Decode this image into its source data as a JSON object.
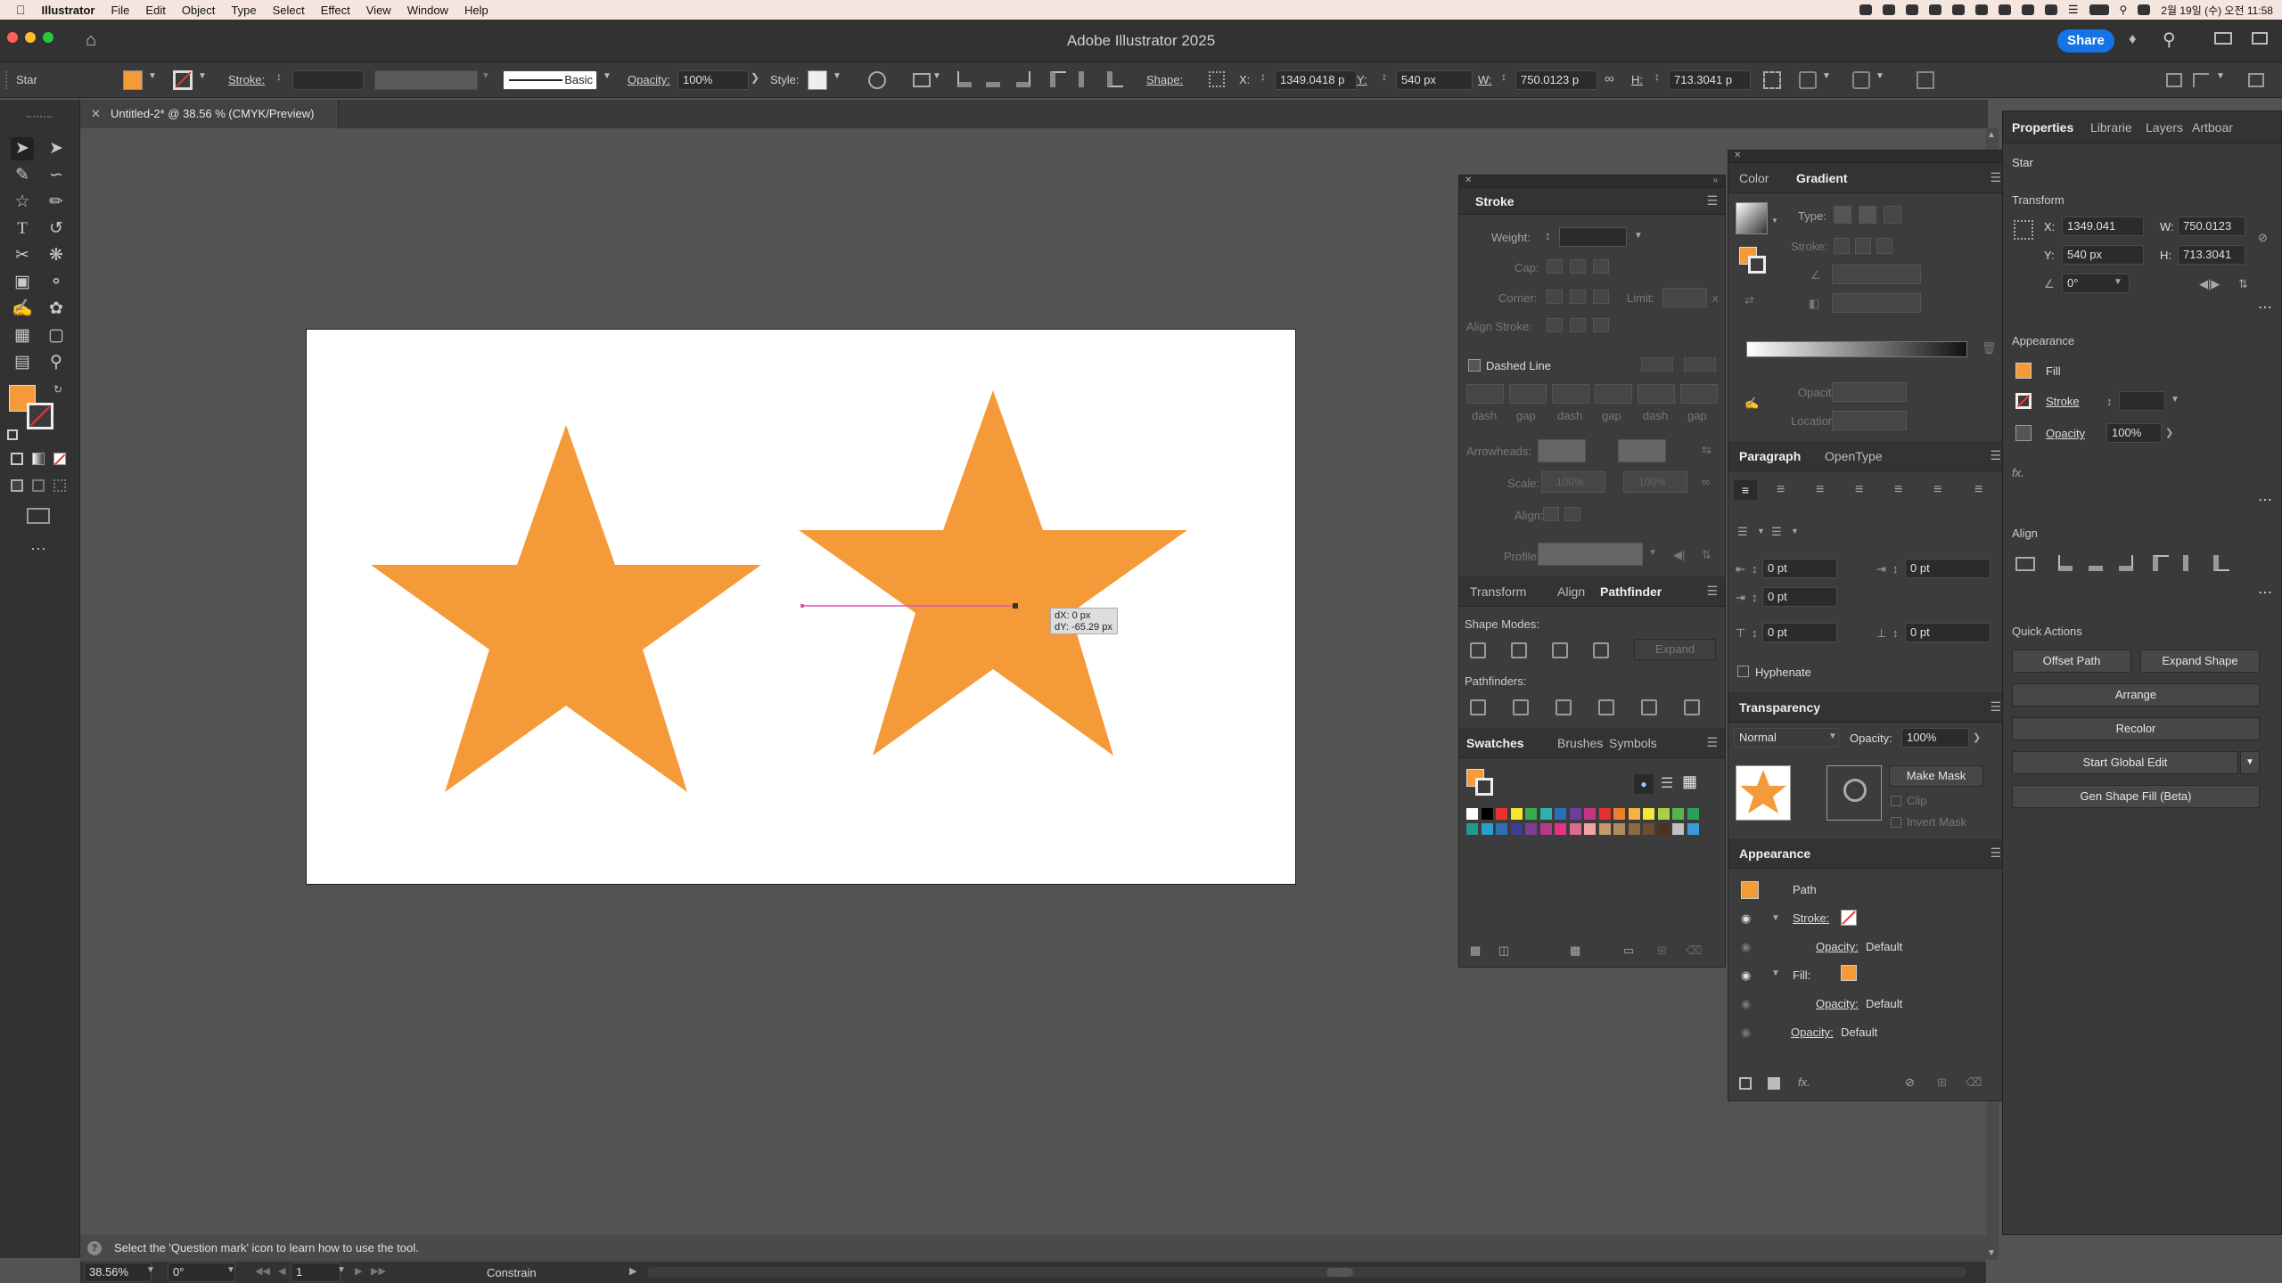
{
  "menubar": {
    "app": "Illustrator",
    "items": [
      "File",
      "Edit",
      "Object",
      "Type",
      "Select",
      "Effect",
      "View",
      "Window",
      "Help"
    ],
    "datetime": "2월 19일 (수) 오전 11:58"
  },
  "titlebar": {
    "title": "Adobe Illustrator 2025",
    "share": "Share"
  },
  "control": {
    "object_type": "Star",
    "stroke_label": "Stroke:",
    "brush_label": "Basic",
    "opacity_label": "Opacity:",
    "opacity_value": "100%",
    "style_label": "Style:",
    "shape_label": "Shape:",
    "x_label": "X:",
    "x_value": "1349.0418 p",
    "y_label": "Y:",
    "y_value": "540 px",
    "w_label": "W:",
    "w_value": "750.0123 p",
    "h_label": "H:",
    "h_value": "713.3041 p"
  },
  "document_tab": {
    "title": "Untitled-2* @ 38.56 % (CMYK/Preview)"
  },
  "canvas": {
    "tooltip_dx": "dX: 0 px",
    "tooltip_dy": "dY: -65.29 px",
    "fill_color": "#f59a38"
  },
  "status": {
    "hint": "Select the 'Question mark' icon to learn how to use the tool.",
    "zoom": "38.56%",
    "rotation": "0°",
    "artboard_num": "1",
    "mode": "Constrain"
  },
  "stroke_panel": {
    "title": "Stroke",
    "weight": "Weight:",
    "cap": "Cap:",
    "corner": "Corner:",
    "limit": "Limit:",
    "limit_x": "x",
    "align_stroke": "Align Stroke:",
    "dashed_line": "Dashed Line",
    "dash_labels": [
      "dash",
      "gap",
      "dash",
      "gap",
      "dash",
      "gap"
    ],
    "arrowheads": "Arrowheads:",
    "scale": "Scale:",
    "align": "Align:",
    "profile": "Profile:",
    "scale_values": [
      "100%",
      "100%"
    ]
  },
  "pathfinder_panel": {
    "tabs": [
      "Transform",
      "Align",
      "Pathfinder"
    ],
    "shape_modes": "Shape Modes:",
    "expand": "Expand",
    "pathfinders": "Pathfinders:"
  },
  "swatches_panel": {
    "tabs": [
      "Swatches",
      "Brushes",
      "Symbols"
    ]
  },
  "color_panel": {
    "tabs": [
      "Color",
      "Gradient"
    ],
    "type": "Type:",
    "stroke": "Stroke:",
    "opacity": "Opacity:",
    "location": "Location:"
  },
  "paragraph_panel": {
    "tabs": [
      "Paragraph",
      "OpenType"
    ],
    "values": [
      "0 pt",
      "0 pt",
      "0 pt",
      "0 pt",
      "0 pt"
    ],
    "hyphenate": "Hyphenate"
  },
  "transparency_panel": {
    "title": "Transparency",
    "mode": "Normal",
    "opacity_label": "Opacity:",
    "opacity_value": "100%",
    "make_mask": "Make Mask",
    "clip": "Clip",
    "invert_mask": "Invert Mask"
  },
  "appearance_panel": {
    "title": "Appearance",
    "path": "Path",
    "stroke": "Stroke:",
    "fill": "Fill:",
    "opacity_label": "Opacity:",
    "opacity_value": "Default"
  },
  "properties_panel": {
    "tabs": [
      "Properties",
      "Librarie",
      "Layers",
      "Artboar"
    ],
    "object": "Star",
    "transform": "Transform",
    "x_label": "X:",
    "x": "1349.041",
    "y_label": "Y:",
    "y": "540 px",
    "w_label": "W:",
    "w": "750.0123",
    "h_label": "H:",
    "h": "713.3041",
    "angle": "0°",
    "appearance": "Appearance",
    "fill": "Fill",
    "stroke": "Stroke",
    "opacity": "Opacity",
    "opacity_value": "100%",
    "align": "Align",
    "quick_actions": "Quick Actions",
    "buttons": [
      "Offset Path",
      "Expand Shape",
      "Arrange",
      "Recolor",
      "Start Global Edit",
      "Gen Shape Fill (Beta)"
    ]
  },
  "swatch_colors": [
    "#ffffff",
    "#000000",
    "#e8322b",
    "#f4ea2a",
    "#3aab4a",
    "#2fb2a9",
    "#2a6fbb",
    "#6a3f99",
    "#c8357f",
    "#e5312e",
    "#ef7e2d",
    "#f6b33f",
    "#f5e63b",
    "#a8cf45",
    "#55b749",
    "#2ca05a",
    "#1d9a8d",
    "#26a0c8",
    "#2e6fb5",
    "#3d3f96",
    "#7e3d95",
    "#b43a8b",
    "#e43383",
    "#d96b8d",
    "#f1a4a6",
    "#c49a6c",
    "#b08a5d",
    "#8d6a42",
    "#6d4c2f",
    "#4d3320",
    "#c0c0c0",
    "#3a9ad9"
  ]
}
